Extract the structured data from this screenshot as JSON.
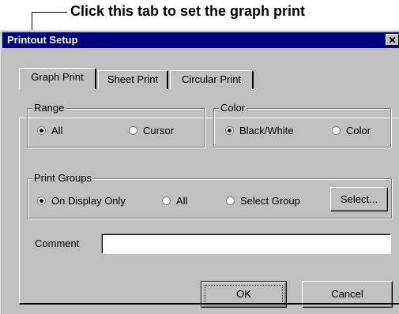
{
  "annotation": {
    "text": "Click this tab to set the graph print"
  },
  "dialog": {
    "title": "Printout Setup",
    "close_glyph": "✕",
    "tabs": [
      {
        "label": "Graph Print",
        "active": true
      },
      {
        "label": "Sheet Print",
        "active": false
      },
      {
        "label": "Circular Print",
        "active": false
      }
    ],
    "range": {
      "legend": "Range",
      "options": [
        {
          "label": "All",
          "selected": true
        },
        {
          "label": "Cursor",
          "selected": false
        }
      ]
    },
    "color": {
      "legend": "Color",
      "options": [
        {
          "label": "Black/White",
          "selected": true
        },
        {
          "label": "Color",
          "selected": false
        }
      ]
    },
    "print_groups": {
      "legend": "Print Groups",
      "options": [
        {
          "label": "On Display Only",
          "selected": true
        },
        {
          "label": "All",
          "selected": false
        },
        {
          "label": "Select Group",
          "selected": false
        }
      ],
      "select_button": "Select..."
    },
    "comment": {
      "label": "Comment",
      "value": ""
    },
    "ok_button": "OK",
    "cancel_button": "Cancel"
  }
}
